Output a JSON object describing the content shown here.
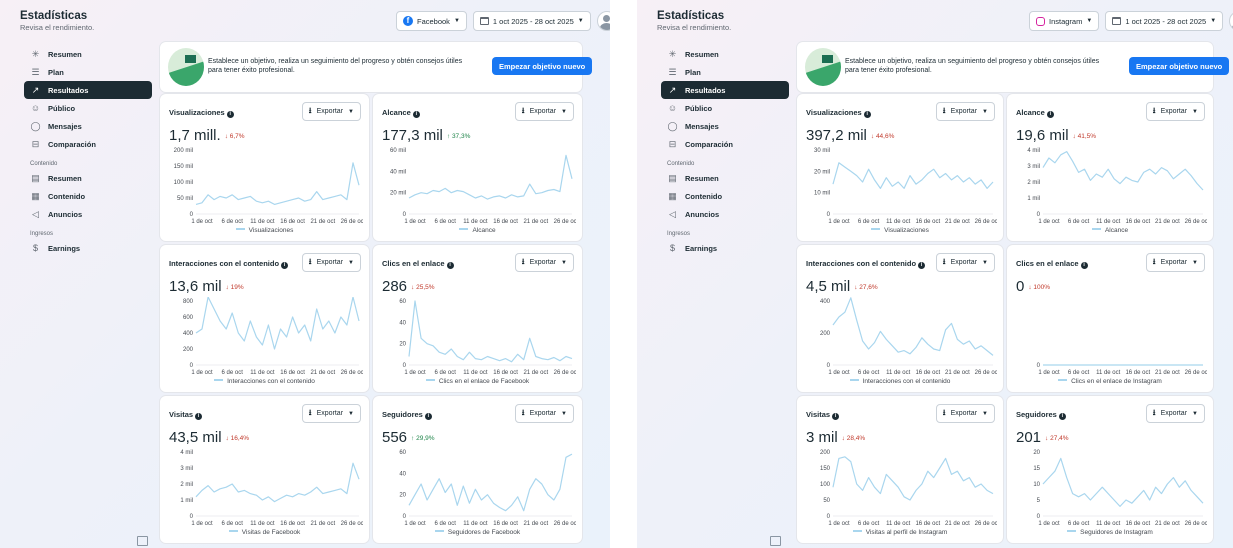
{
  "panels": [
    {
      "header": {
        "title": "Estadísticas",
        "subtitle": "Revisa el rendimiento."
      },
      "platform": {
        "label": "Facebook",
        "icon": "facebook-icon"
      },
      "date_range": "1 oct 2025 - 28 oct 2025",
      "sidebar": {
        "items": [
          {
            "label": "Resumen",
            "icon": "sparkle-icon",
            "active": false
          },
          {
            "label": "Plan",
            "icon": "list-icon",
            "active": false
          },
          {
            "label": "Resultados",
            "icon": "trend-icon",
            "active": true
          },
          {
            "label": "Público",
            "icon": "people-icon",
            "active": false
          },
          {
            "label": "Mensajes",
            "icon": "chat-icon",
            "active": false
          },
          {
            "label": "Comparación",
            "icon": "compare-icon",
            "active": false
          }
        ],
        "section_contenido": "Contenido",
        "content_items": [
          {
            "label": "Resumen",
            "icon": "doc-icon"
          },
          {
            "label": "Contenido",
            "icon": "grid-icon"
          },
          {
            "label": "Anuncios",
            "icon": "megaphone-icon"
          }
        ],
        "section_ingresos": "Ingresos",
        "income_items": [
          {
            "label": "Earnings",
            "icon": "dollar-icon"
          }
        ]
      },
      "banner": {
        "text": "Establece un objetivo, realiza un seguimiento del progreso y obtén consejos útiles para tener éxito profesional.",
        "button": "Empezar objetivo nuevo"
      },
      "export_label": "Exportar",
      "cards": [
        {
          "title": "Visualizaciones",
          "value": "1,7 mill.",
          "change": "6,7%",
          "direction": "down",
          "legend": "Visualizaciones",
          "y_ticks": [
            "200 mil",
            "150 mil",
            "100 mil",
            "50 mil",
            "0"
          ]
        },
        {
          "title": "Alcance",
          "value": "177,3 mil",
          "change": "37,3%",
          "direction": "up",
          "legend": "Alcance",
          "y_ticks": [
            "60 mil",
            "40 mil",
            "20 mil",
            "0"
          ]
        },
        {
          "title": "Interacciones con el contenido",
          "value": "13,6 mil",
          "change": "19%",
          "direction": "down",
          "legend": "Interacciones con el contenido",
          "y_ticks": [
            "800",
            "600",
            "400",
            "200",
            "0"
          ]
        },
        {
          "title": "Clics en el enlace",
          "value": "286",
          "change": "25,5%",
          "direction": "down",
          "legend": "Clics en el enlace de Facebook",
          "y_ticks": [
            "60",
            "40",
            "20",
            "0"
          ]
        },
        {
          "title": "Visitas",
          "value": "43,5 mil",
          "change": "16,4%",
          "direction": "down",
          "legend": "Visitas de Facebook",
          "y_ticks": [
            "4 mil",
            "3 mil",
            "2 mil",
            "1 mil",
            "0"
          ]
        },
        {
          "title": "Seguidores",
          "value": "556",
          "change": "29,9%",
          "direction": "up",
          "legend": "Seguidores de Facebook",
          "y_ticks": [
            "60",
            "40",
            "20",
            "0"
          ]
        }
      ]
    },
    {
      "header": {
        "title": "Estadísticas",
        "subtitle": "Revisa el rendimiento."
      },
      "platform": {
        "label": "Instagram",
        "icon": "instagram-icon"
      },
      "date_range": "1 oct 2025 - 28 oct 2025",
      "sidebar": {
        "items": [
          {
            "label": "Resumen",
            "icon": "sparkle-icon",
            "active": false
          },
          {
            "label": "Plan",
            "icon": "list-icon",
            "active": false
          },
          {
            "label": "Resultados",
            "icon": "trend-icon",
            "active": true
          },
          {
            "label": "Público",
            "icon": "people-icon",
            "active": false
          },
          {
            "label": "Mensajes",
            "icon": "chat-icon",
            "active": false
          },
          {
            "label": "Comparación",
            "icon": "compare-icon",
            "active": false
          }
        ],
        "section_contenido": "Contenido",
        "content_items": [
          {
            "label": "Resumen",
            "icon": "doc-icon"
          },
          {
            "label": "Contenido",
            "icon": "grid-icon"
          },
          {
            "label": "Anuncios",
            "icon": "megaphone-icon"
          }
        ],
        "section_ingresos": "Ingresos",
        "income_items": [
          {
            "label": "Earnings",
            "icon": "dollar-icon"
          }
        ]
      },
      "banner": {
        "text": "Establece un objetivo, realiza un seguimiento del progreso y obtén consejos útiles para tener éxito profesional.",
        "button": "Empezar objetivo nuevo"
      },
      "export_label": "Exportar",
      "cards": [
        {
          "title": "Visualizaciones",
          "value": "397,2 mil",
          "change": "44,6%",
          "direction": "down",
          "legend": "Visualizaciones",
          "y_ticks": [
            "30 mil",
            "20 mil",
            "10 mil",
            "0"
          ]
        },
        {
          "title": "Alcance",
          "value": "19,6 mil",
          "change": "41,5%",
          "direction": "down",
          "legend": "Alcance",
          "y_ticks": [
            "4 mil",
            "3 mil",
            "2 mil",
            "1 mil",
            "0"
          ]
        },
        {
          "title": "Interacciones con el contenido",
          "value": "4,5 mil",
          "change": "27,6%",
          "direction": "down",
          "legend": "Interacciones con el contenido",
          "y_ticks": [
            "400",
            "200",
            "0"
          ]
        },
        {
          "title": "Clics en el enlace",
          "value": "0",
          "change": "100%",
          "direction": "down",
          "legend": "Clics en el enlace de Instagram",
          "y_ticks": [
            "0"
          ]
        },
        {
          "title": "Visitas",
          "value": "3 mil",
          "change": "28,4%",
          "direction": "down",
          "legend": "Visitas al perfil de Instagram",
          "y_ticks": [
            "200",
            "150",
            "100",
            "50",
            "0"
          ]
        },
        {
          "title": "Seguidores",
          "value": "201",
          "change": "27,4%",
          "direction": "down",
          "legend": "Seguidores de Instagram",
          "y_ticks": [
            "20",
            "15",
            "10",
            "5",
            "0"
          ]
        }
      ]
    }
  ],
  "colors": {
    "accent": "#1877f2",
    "line": "#a9d6ee",
    "active_nav": "#1c2b33",
    "down": "#c0392b",
    "up": "#1e8449"
  },
  "chart_data": [
    {
      "type": "line",
      "title": "Visualizaciones",
      "x": [
        "1 de oct",
        "6 de oct",
        "11 de oct",
        "16 de oct",
        "21 de oct",
        "26 de oct"
      ],
      "ylim": [
        0,
        200000
      ],
      "series": [
        {
          "name": "Visualizaciones",
          "values": [
            30000,
            35000,
            60000,
            45000,
            55000,
            50000,
            60000,
            45000,
            50000,
            55000,
            40000,
            35000,
            40000,
            30000,
            35000,
            40000,
            45000,
            50000,
            40000,
            45000,
            70000,
            45000,
            50000,
            55000,
            60000,
            45000,
            160000,
            90000
          ]
        }
      ]
    },
    {
      "type": "line",
      "title": "Alcance",
      "x": [
        "1 de oct",
        "6 de oct",
        "11 de oct",
        "16 de oct",
        "21 de oct",
        "26 de oct"
      ],
      "ylim": [
        0,
        60000
      ],
      "series": [
        {
          "name": "Alcance",
          "values": [
            15000,
            18000,
            20000,
            19000,
            22000,
            21000,
            24000,
            20000,
            22000,
            21000,
            18000,
            15000,
            17000,
            14000,
            16000,
            17000,
            15000,
            18000,
            16000,
            17000,
            28000,
            19000,
            20000,
            22000,
            23000,
            21000,
            55000,
            33000
          ]
        }
      ]
    },
    {
      "type": "line",
      "title": "Interacciones con el contenido",
      "x": [
        "1 de oct",
        "6 de oct",
        "11 de oct",
        "16 de oct",
        "21 de oct",
        "26 de oct"
      ],
      "ylim": [
        0,
        800
      ],
      "series": [
        {
          "name": "Interacciones con el contenido",
          "values": [
            400,
            450,
            850,
            700,
            550,
            450,
            650,
            400,
            300,
            550,
            350,
            250,
            500,
            200,
            450,
            350,
            600,
            400,
            500,
            300,
            700,
            450,
            550,
            400,
            600,
            500,
            850,
            550
          ]
        }
      ]
    },
    {
      "type": "line",
      "title": "Clics en el enlace",
      "x": [
        "1 de oct",
        "6 de oct",
        "11 de oct",
        "16 de oct",
        "21 de oct",
        "26 de oct"
      ],
      "ylim": [
        0,
        60
      ],
      "series": [
        {
          "name": "Clics en el enlace de Facebook",
          "values": [
            8,
            60,
            25,
            20,
            18,
            12,
            10,
            15,
            8,
            5,
            12,
            6,
            5,
            8,
            6,
            4,
            6,
            3,
            10,
            5,
            25,
            8,
            6,
            5,
            7,
            4,
            8,
            6
          ]
        }
      ]
    },
    {
      "type": "line",
      "title": "Visitas",
      "x": [
        "1 de oct",
        "6 de oct",
        "11 de oct",
        "16 de oct",
        "21 de oct",
        "26 de oct"
      ],
      "ylim": [
        0,
        4000
      ],
      "series": [
        {
          "name": "Visitas de Facebook",
          "values": [
            1200,
            1600,
            1900,
            1500,
            1700,
            1800,
            2000,
            1500,
            1600,
            1400,
            1300,
            1000,
            1200,
            900,
            1100,
            1300,
            1200,
            1400,
            1300,
            1500,
            1800,
            1400,
            1500,
            1600,
            1700,
            1400,
            3300,
            2300
          ]
        }
      ]
    },
    {
      "type": "line",
      "title": "Seguidores",
      "x": [
        "1 de oct",
        "6 de oct",
        "11 de oct",
        "16 de oct",
        "21 de oct",
        "26 de oct"
      ],
      "ylim": [
        0,
        60
      ],
      "series": [
        {
          "name": "Seguidores de Facebook",
          "values": [
            10,
            20,
            30,
            15,
            25,
            35,
            22,
            30,
            10,
            28,
            12,
            25,
            15,
            20,
            12,
            8,
            5,
            10,
            18,
            5,
            25,
            35,
            30,
            20,
            15,
            25,
            55,
            58
          ]
        }
      ]
    },
    {
      "type": "line",
      "title": "Visualizaciones",
      "x": [
        "1 de oct",
        "6 de oct",
        "11 de oct",
        "16 de oct",
        "21 de oct",
        "26 de oct"
      ],
      "ylim": [
        0,
        30000
      ],
      "series": [
        {
          "name": "Visualizaciones",
          "values": [
            14000,
            24000,
            22000,
            20000,
            18000,
            15000,
            21000,
            16000,
            12000,
            17000,
            13000,
            15000,
            12000,
            18000,
            14000,
            16000,
            19000,
            21000,
            17000,
            19000,
            16000,
            18000,
            15000,
            17000,
            14000,
            16000,
            12000,
            15000
          ]
        }
      ]
    },
    {
      "type": "line",
      "title": "Alcance",
      "x": [
        "1 de oct",
        "6 de oct",
        "11 de oct",
        "16 de oct",
        "21 de oct",
        "26 de oct"
      ],
      "ylim": [
        0,
        4000
      ],
      "series": [
        {
          "name": "Alcance",
          "values": [
            2900,
            3500,
            3200,
            3700,
            3900,
            3300,
            2600,
            2800,
            2100,
            2500,
            2300,
            2800,
            2200,
            1900,
            2300,
            2100,
            2000,
            2600,
            2800,
            2500,
            2900,
            2700,
            2200,
            2500,
            2800,
            2400,
            1900,
            1500
          ]
        }
      ]
    },
    {
      "type": "line",
      "title": "Interacciones con el contenido",
      "x": [
        "1 de oct",
        "6 de oct",
        "11 de oct",
        "16 de oct",
        "21 de oct",
        "26 de oct"
      ],
      "ylim": [
        0,
        400
      ],
      "series": [
        {
          "name": "Interacciones con el contenido",
          "values": [
            250,
            300,
            330,
            420,
            280,
            150,
            100,
            140,
            210,
            160,
            120,
            80,
            90,
            70,
            110,
            170,
            130,
            100,
            90,
            220,
            260,
            160,
            130,
            150,
            100,
            120,
            90,
            60
          ]
        }
      ]
    },
    {
      "type": "line",
      "title": "Clics en el enlace",
      "x": [
        "1 de oct",
        "6 de oct",
        "11 de oct",
        "16 de oct",
        "21 de oct",
        "26 de oct"
      ],
      "ylim": [
        0,
        1
      ],
      "series": [
        {
          "name": "Clics en el enlace de Instagram",
          "values": [
            0,
            0,
            0,
            0,
            0,
            0,
            0,
            0,
            0,
            0,
            0,
            0,
            0,
            0,
            0,
            0,
            0,
            0,
            0,
            0,
            0,
            0,
            0,
            0,
            0,
            0,
            0,
            0
          ]
        }
      ]
    },
    {
      "type": "line",
      "title": "Visitas",
      "x": [
        "1 de oct",
        "6 de oct",
        "11 de oct",
        "16 de oct",
        "21 de oct",
        "26 de oct"
      ],
      "ylim": [
        0,
        200
      ],
      "series": [
        {
          "name": "Visitas al perfil de Instagram",
          "values": [
            90,
            180,
            185,
            170,
            100,
            80,
            120,
            90,
            70,
            130,
            110,
            90,
            60,
            50,
            80,
            100,
            140,
            120,
            150,
            180,
            130,
            140,
            110,
            120,
            90,
            100,
            80,
            70
          ]
        }
      ]
    },
    {
      "type": "line",
      "title": "Seguidores",
      "x": [
        "1 de oct",
        "6 de oct",
        "11 de oct",
        "16 de oct",
        "21 de oct",
        "26 de oct"
      ],
      "ylim": [
        0,
        20
      ],
      "series": [
        {
          "name": "Seguidores de Instagram",
          "values": [
            10,
            12,
            14,
            18,
            12,
            7,
            6,
            7,
            5,
            7,
            9,
            7,
            5,
            3,
            5,
            4,
            6,
            8,
            5,
            9,
            7,
            10,
            12,
            9,
            11,
            8,
            6,
            4
          ]
        }
      ]
    }
  ]
}
